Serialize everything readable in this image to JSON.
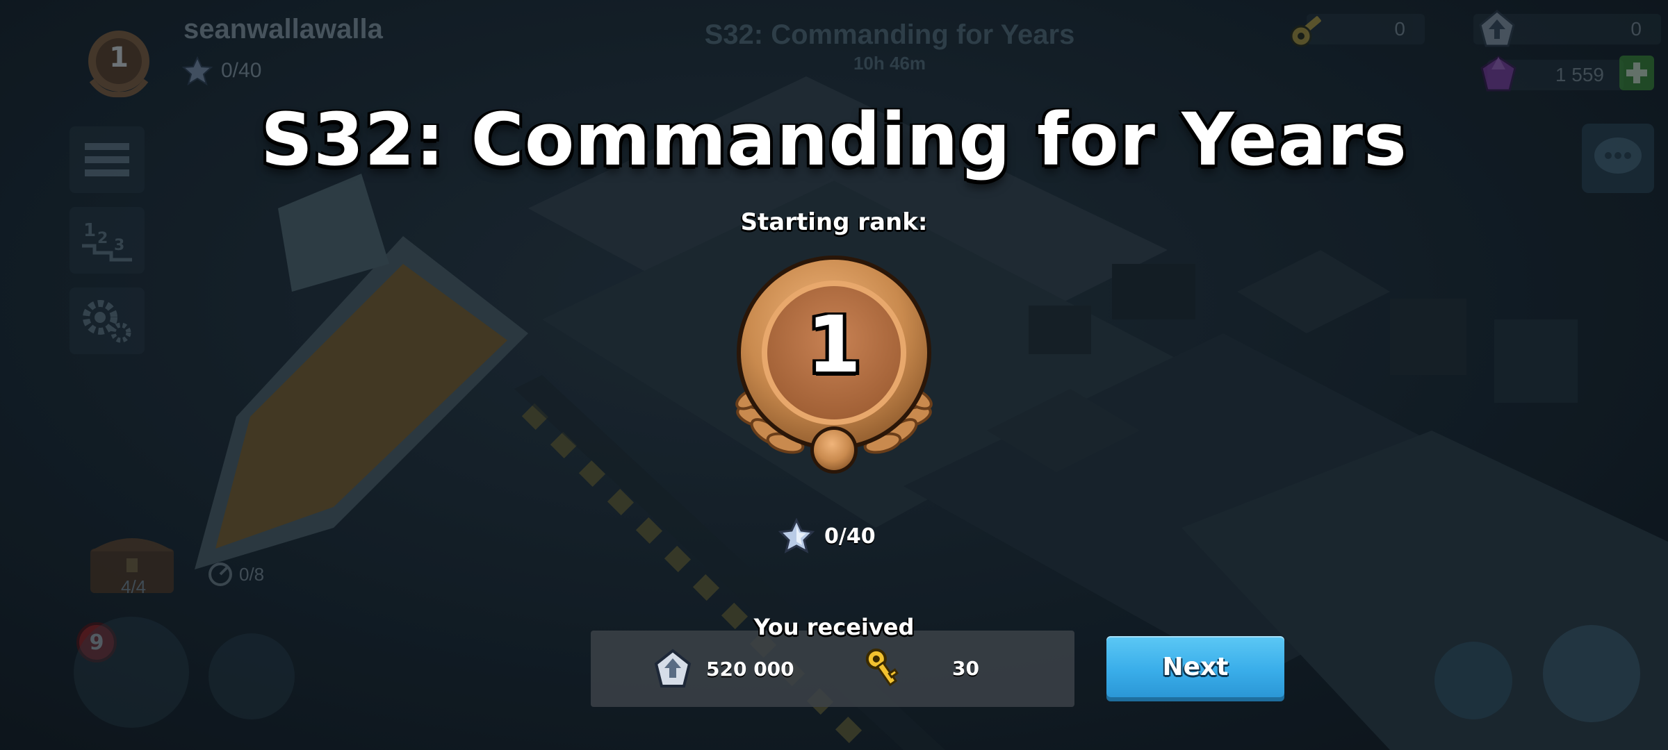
{
  "hud": {
    "player_name": "seanwallawalla",
    "player_rank": "1",
    "player_stars": "0/40",
    "season_title_faded": "S32: Commanding for Years",
    "season_timer": "10h 46m",
    "resources": {
      "keys": "0",
      "intel": "0",
      "diamonds": "1 559"
    },
    "chest_count": "4/4",
    "intel_count": "0/8",
    "notification_badge": "9"
  },
  "modal": {
    "title": "S32: Commanding for Years",
    "starting_rank_label": "Starting rank:",
    "rank_number": "1",
    "stars_progress": "0/40",
    "received_label": "You received",
    "rewards": [
      {
        "icon": "intel-icon",
        "amount": "520 000"
      },
      {
        "icon": "key-icon",
        "amount": "30"
      }
    ],
    "next_button": "Next"
  },
  "colors": {
    "bronze": "#c98a4e",
    "next_button": "#3aaeea",
    "key_yellow": "#f2c230",
    "gem_purple": "#a24cc7",
    "plus_green": "#46b83a"
  }
}
